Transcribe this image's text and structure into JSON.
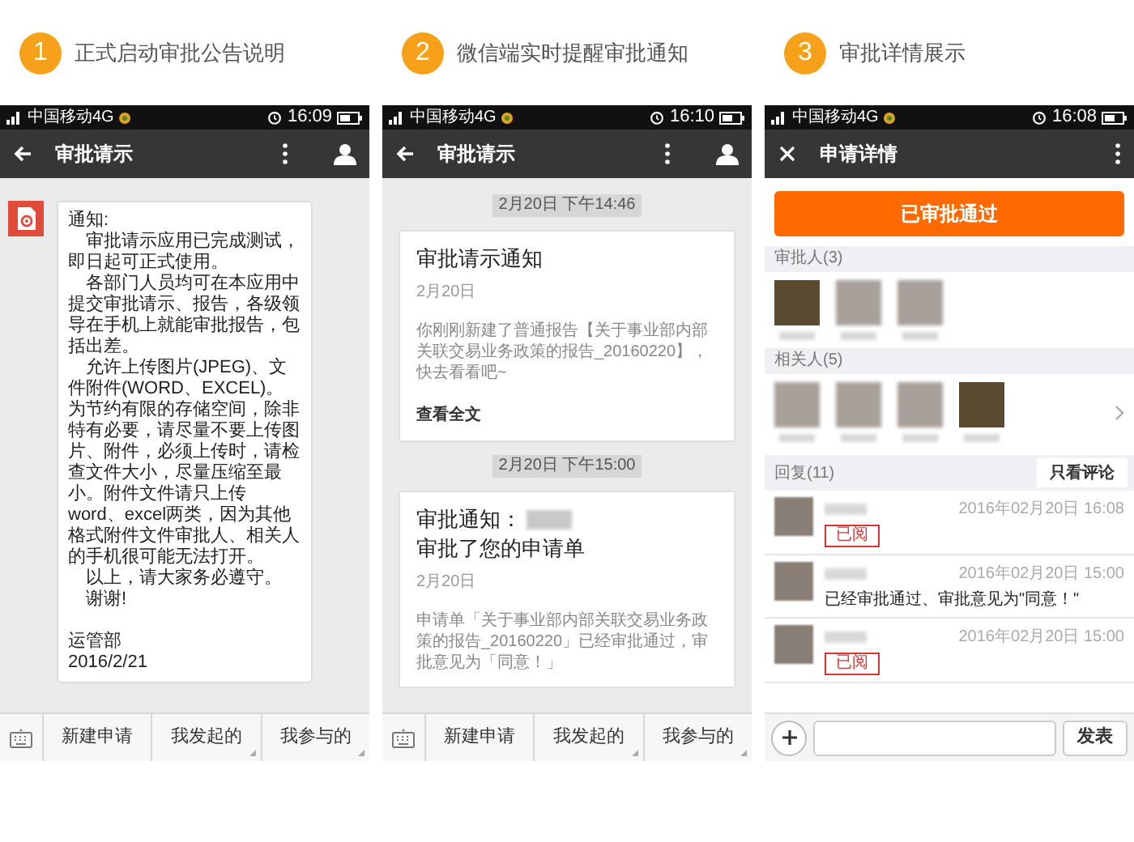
{
  "panels": [
    {
      "kind": "chat",
      "number": "1",
      "heading": "正式启动审批公告说明",
      "status": {
        "carrier": "中国移动4G",
        "time": "16:09"
      },
      "titlebar": {
        "kind": "back",
        "title": "审批请示",
        "profile": true
      },
      "message": {
        "paragraphs": [
          {
            "text": "通知:",
            "indent": false
          },
          {
            "text": "审批请示应用已完成测试，即日起可正式使用。",
            "indent": true
          },
          {
            "text": "各部门人员均可在本应用中提交审批请示、报告，各级领导在手机上就能审批报告，包括出差。",
            "indent": true
          },
          {
            "text": "允许上传图片(JPEG)、文件附件(WORD、EXCEL)。为节约有限的存储空间，除非特有必要，请尽量不要上传图片、附件，必须上传时，请检查文件大小，尽量压缩至最小。附件文件请只上传word、excel两类，因为其他格式附件文件审批人、相关人的手机很可能无法打开。",
            "indent": true
          },
          {
            "text": "以上，请大家务必遵守。",
            "indent": true
          },
          {
            "text": "谢谢!",
            "indent": true
          }
        ],
        "signature": [
          "运管部",
          "2016/2/21"
        ]
      },
      "menu": [
        {
          "label": "新建申请",
          "submenu": false
        },
        {
          "label": "我发起的",
          "submenu": true
        },
        {
          "label": "我参与的",
          "submenu": true
        }
      ]
    },
    {
      "kind": "notifications",
      "number": "2",
      "heading": "微信端实时提醒审批通知",
      "status": {
        "carrier": "中国移动4G",
        "time": "16:10"
      },
      "titlebar": {
        "kind": "back",
        "title": "审批请示",
        "profile": true
      },
      "cards": [
        {
          "time": "2月20日 下午14:46",
          "title": "审批请示通知",
          "date": "2月20日",
          "body": "你刚刚新建了普通报告【关于事业部内部关联交易业务政策的报告_20160220】，快去看看吧~",
          "link": "查看全文"
        },
        {
          "time": "2月20日 下午15:00",
          "title": "审批通知：",
          "title_rest": "审批了您的申请单",
          "date": "2月20日",
          "body": "申请单「关于事业部内部关联交易业务政策的报告_20160220」已经审批通过，审批意见为「同意！」"
        }
      ],
      "menu": [
        {
          "label": "新建申请",
          "submenu": false
        },
        {
          "label": "我发起的",
          "submenu": true
        },
        {
          "label": "我参与的",
          "submenu": true
        }
      ]
    },
    {
      "kind": "detail",
      "number": "3",
      "heading": "审批详情展示",
      "status": {
        "carrier": "中国移动4G",
        "time": "16:08"
      },
      "titlebar": {
        "kind": "close",
        "title": "申请详情",
        "profile": false
      },
      "status_banner": "已审批通过",
      "groups": [
        {
          "label": "审批人(3)",
          "more": false,
          "avatars": [
            {
              "kind": "photo"
            },
            {
              "kind": "blurred"
            },
            {
              "kind": "blurred"
            }
          ]
        },
        {
          "label": "相关人(5)",
          "more": true,
          "avatars": [
            {
              "kind": "blurred"
            },
            {
              "kind": "blurred"
            },
            {
              "kind": "blurred"
            },
            {
              "kind": "photo"
            }
          ]
        }
      ],
      "replies_label": "回复(11)",
      "filter_button": "只看评论",
      "replies": [
        {
          "time": "2016年02月20日 16:08",
          "kind": "stamp",
          "text": "已阅"
        },
        {
          "time": "2016年02月20日 15:00",
          "kind": "text",
          "text": "已经审批通过、审批意见为\"同意！\""
        },
        {
          "time": "2016年02月20日 15:00",
          "kind": "stamp",
          "text": "已阅"
        }
      ],
      "send_button": "发表"
    }
  ]
}
